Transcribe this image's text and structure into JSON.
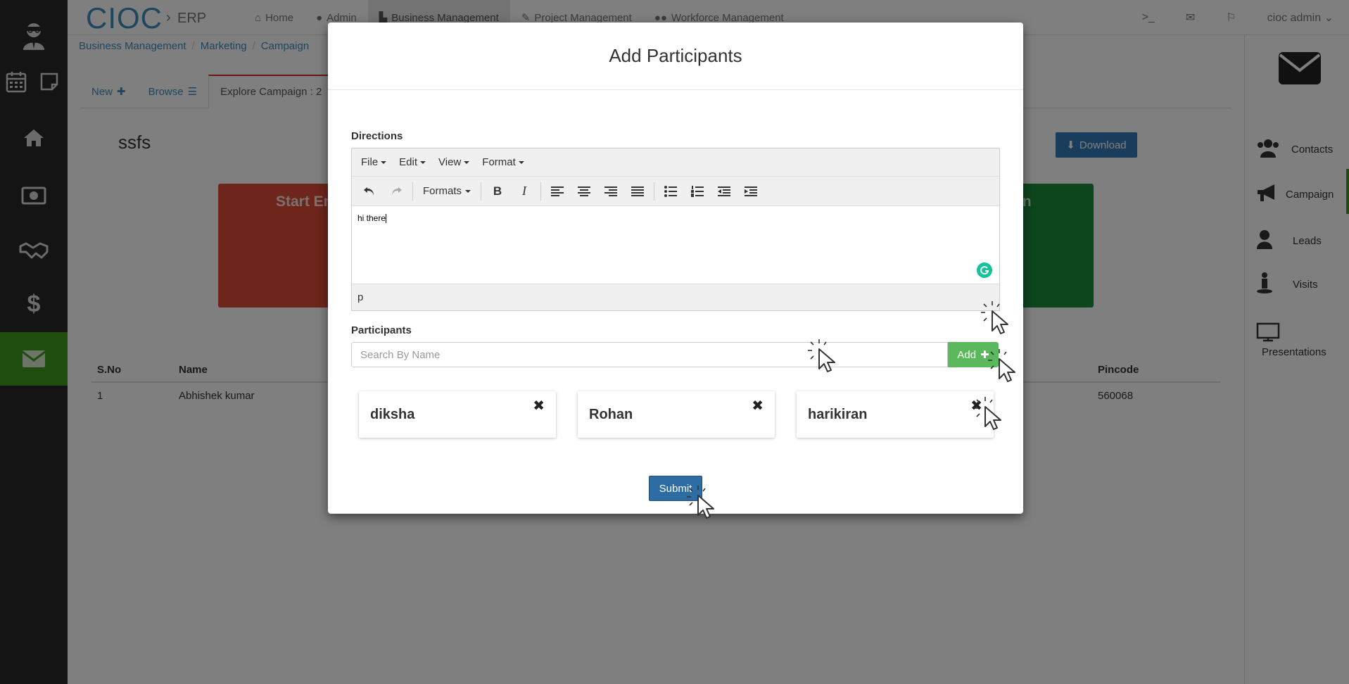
{
  "app": {
    "brand": "CIOC",
    "brand_sep": "›",
    "brand_sub": "ERP"
  },
  "topnav": {
    "links": [
      {
        "label": "Home",
        "icon": "home-icon"
      },
      {
        "label": "Admin",
        "icon": "user-icon"
      },
      {
        "label": "Business Management",
        "icon": "factory-icon"
      },
      {
        "label": "Project Management",
        "icon": "wrench-icon"
      },
      {
        "label": "Workforce Management",
        "icon": "users-icon"
      }
    ],
    "active_index": 2,
    "user_label": "cioc admin"
  },
  "breadcrumb": [
    "Business Management",
    "Marketing",
    "Campaign"
  ],
  "tabs": [
    {
      "label": "New",
      "icon": "plus-icon"
    },
    {
      "label": "Browse",
      "icon": "list-icon"
    },
    {
      "label": "Explore Campaign : 2"
    }
  ],
  "page": {
    "title": "ssfs",
    "download_label": "Download",
    "tile_left_label": "Start Em",
    "tile_right_label": "gn"
  },
  "bg_table": {
    "headers": [
      "S.No",
      "Name",
      "Pincode"
    ],
    "rows": [
      [
        "1",
        "Abhishek kumar",
        "560068"
      ]
    ]
  },
  "rightbar": {
    "items": [
      "Contacts",
      "Campaign",
      "Leads",
      "Visits",
      "Presentations"
    ]
  },
  "modal": {
    "title": "Add Participants",
    "directions_label": "Directions",
    "editor": {
      "menus": [
        "File",
        "Edit",
        "View",
        "Format"
      ],
      "formats_label": "Formats",
      "content": "hi there",
      "status_path": "p"
    },
    "participants_label": "Participants",
    "search_placeholder": "Search By Name",
    "add_label": "Add",
    "participants": [
      "diksha",
      "Rohan",
      "harikiran"
    ],
    "remove_glyph": "✖",
    "submit_label": "Submit"
  },
  "colors": {
    "primary": "#337ab7",
    "success": "#5cb85c",
    "sidebar_bg": "#292929",
    "sidebar_active": "#3d9a1d",
    "tile_red": "#dd4b39",
    "tile_green": "#1a8a3a"
  }
}
